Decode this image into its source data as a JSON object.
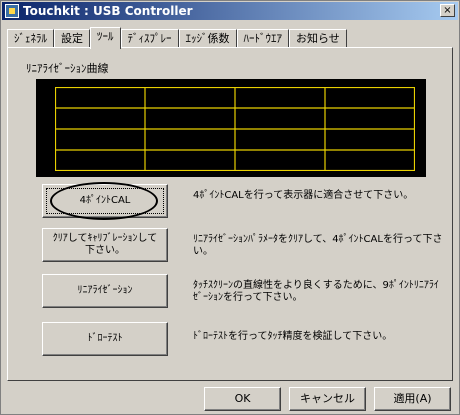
{
  "window": {
    "title": "Touchkit : USB Controller",
    "close_glyph": "×"
  },
  "tabs": [
    {
      "label": "ｼﾞｪﾈﾗﾙ"
    },
    {
      "label": "設定"
    },
    {
      "label": "ﾂｰﾙ",
      "active": true
    },
    {
      "label": "ﾃﾞｨｽﾌﾟﾚｰ"
    },
    {
      "label": "ｴｯｼﾞ係数"
    },
    {
      "label": "ﾊｰﾄﾞｳｴｱ"
    },
    {
      "label": "お知らせ"
    }
  ],
  "linearization": {
    "label": "ﾘﾆｱﾗｲｾﾞｰｼｮﾝ曲線",
    "grid_color": "#e8d000"
  },
  "actions": [
    {
      "button": "4ﾎﾟｲﾝﾄCAL",
      "description": "4ﾎﾟｲﾝﾄCALを行って表示器に適合させて下さい。"
    },
    {
      "button": "ｸﾘｱしてｷｬﾘﾌﾞﾚｰｼｮﾝして下さい。",
      "description": "ﾘﾆｱﾗｲｾﾞｰｼｮﾝﾊﾟﾗﾒｰﾀをｸﾘｱして、4ﾎﾟｲﾝﾄCALを行って下さい。"
    },
    {
      "button": "ﾘﾆｱﾗｲｾﾞｰｼｮﾝ",
      "description": "ﾀｯﾁｽｸﾘｰﾝの直線性をより良くするために、9ﾎﾟｲﾝﾄﾘﾆｱﾗｲｾﾞｰｼｮﾝを行って下さい。"
    },
    {
      "button": "ﾄﾞﾛｰﾃｽﾄ",
      "description": "ﾄﾞﾛｰﾃｽﾄを行ってﾀｯﾁ精度を検証して下さい。"
    }
  ],
  "footer": {
    "ok": "OK",
    "cancel": "キャンセル",
    "apply": "適用(A)"
  }
}
